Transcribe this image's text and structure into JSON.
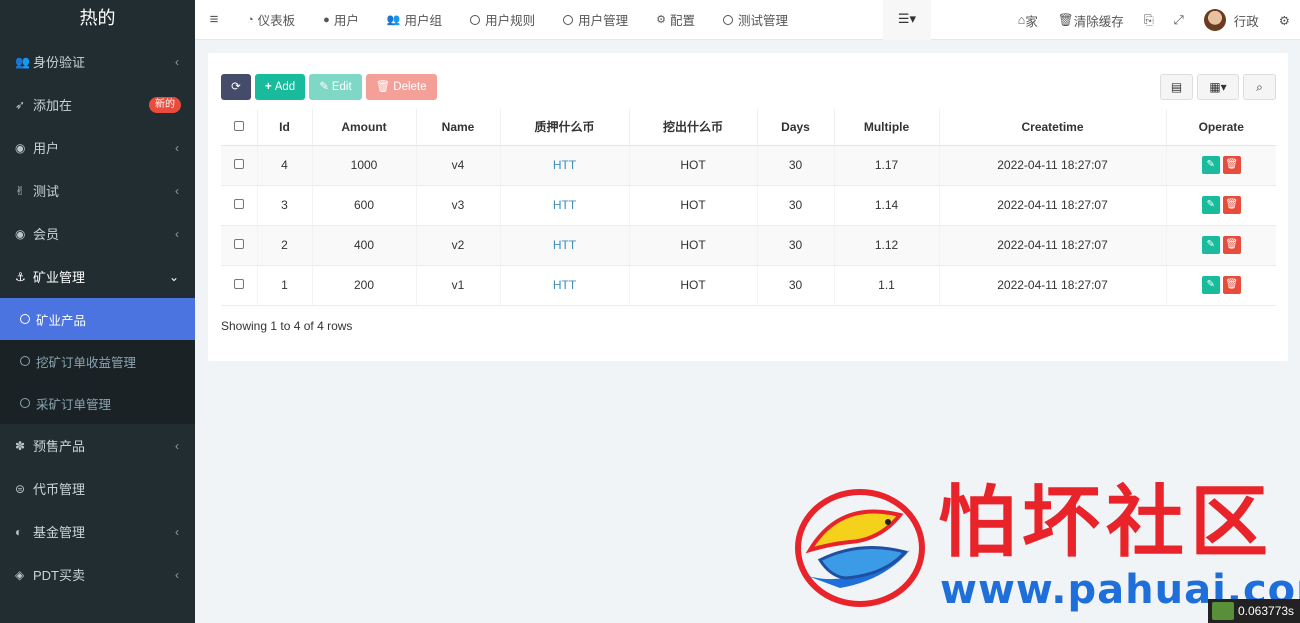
{
  "brand": "热的",
  "sidebar": {
    "items": [
      {
        "label": "身份验证",
        "icon": "users-icon",
        "caret": "‹"
      },
      {
        "label": "添加在",
        "icon": "rocket-icon",
        "badge": "新的"
      },
      {
        "label": "用户",
        "icon": "user-circle-icon",
        "caret": "‹"
      },
      {
        "label": "测试",
        "icon": "hand-icon",
        "caret": "‹"
      },
      {
        "label": "会员",
        "icon": "user-circle-icon",
        "caret": "‹"
      },
      {
        "label": "矿业管理",
        "icon": "anchor-icon",
        "caret": "⌄"
      }
    ],
    "submenu": [
      {
        "label": "矿业产品",
        "active": true
      },
      {
        "label": "挖矿订单收益管理",
        "active": false
      },
      {
        "label": "采矿订单管理",
        "active": false
      }
    ],
    "items_after": [
      {
        "label": "预售产品",
        "icon": "yelp-icon",
        "caret": "‹"
      },
      {
        "label": "代币管理",
        "icon": "bitcoin-icon",
        "caret": ""
      },
      {
        "label": "基金管理",
        "icon": "adjust-icon",
        "caret": "‹"
      },
      {
        "label": "PDT买卖",
        "icon": "compass-icon",
        "caret": "‹"
      }
    ]
  },
  "topnav": {
    "links": [
      {
        "label": "仪表板",
        "icon": "dashboard-icon"
      },
      {
        "label": "用户",
        "icon": "user-icon"
      },
      {
        "label": "用户组",
        "icon": "users-icon"
      },
      {
        "label": "用户规则",
        "icon": "circle-icon"
      },
      {
        "label": "用户管理",
        "icon": "circle-icon"
      },
      {
        "label": "配置",
        "icon": "gear-icon"
      },
      {
        "label": "测试管理",
        "icon": "circle-icon"
      }
    ],
    "home": "家",
    "clear_cache": "清除缓存",
    "username": "行政"
  },
  "toolbar": {
    "add": "Add",
    "edit": "Edit",
    "delete": "Delete"
  },
  "table": {
    "headers": [
      "Id",
      "Amount",
      "Name",
      "质押什么币",
      "挖出什么币",
      "Days",
      "Multiple",
      "Createtime",
      "Operate"
    ],
    "rows": [
      {
        "id": "4",
        "amount": "1000",
        "name": "v4",
        "stake": "HTT",
        "mine": "HOT",
        "days": "30",
        "multiple": "1.17",
        "createtime": "2022-04-11 18:27:07"
      },
      {
        "id": "3",
        "amount": "600",
        "name": "v3",
        "stake": "HTT",
        "mine": "HOT",
        "days": "30",
        "multiple": "1.14",
        "createtime": "2022-04-11 18:27:07"
      },
      {
        "id": "2",
        "amount": "400",
        "name": "v2",
        "stake": "HTT",
        "mine": "HOT",
        "days": "30",
        "multiple": "1.12",
        "createtime": "2022-04-11 18:27:07"
      },
      {
        "id": "1",
        "amount": "200",
        "name": "v1",
        "stake": "HTT",
        "mine": "HOT",
        "days": "30",
        "multiple": "1.1",
        "createtime": "2022-04-11 18:27:07"
      }
    ],
    "footer": "Showing 1 to 4 of 4 rows"
  },
  "watermark": {
    "title": "怕坏社区",
    "url": "www.pahuai.com"
  },
  "timer": "0.063773s",
  "colors": {
    "sidebar_bg": "#222d32",
    "active": "#4b74e0",
    "success": "#18bc9c",
    "danger": "#e74c3c",
    "link": "#3c8dbc"
  }
}
